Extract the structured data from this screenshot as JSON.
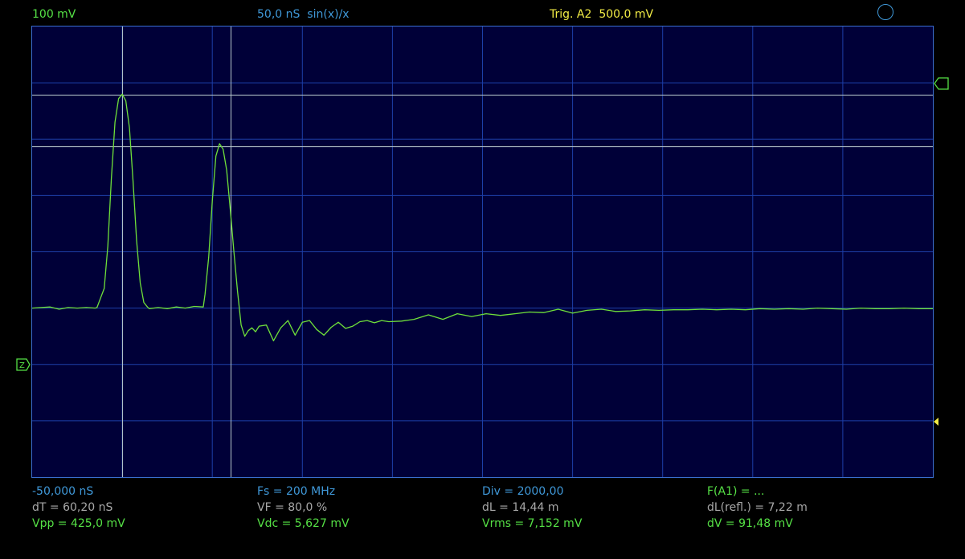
{
  "header": {
    "volts_div": "100 mV",
    "timebase": "50,0 nS",
    "interpolation": "sin(x)/x",
    "trigger_source": "Trig. A2",
    "trigger_level": "500,0 mV"
  },
  "colors": {
    "trace": "#6fe03a",
    "grid": "#1d3fa8",
    "plot_background": "#000038",
    "cursor": "#b8c8cc",
    "label_green": "#55e045",
    "label_blue": "#3f98d8",
    "label_yellow": "#f2ec45",
    "label_gray": "#a8a8a8"
  },
  "markers": {
    "zero_icon": "ground-zero-marker-icon",
    "trigger_icon": "trigger-level-marker-icon",
    "offset_icon": "offset-arrow-icon"
  },
  "measurements": {
    "row1": {
      "start_time": "-50,000 nS",
      "sample_rate": "Fs = 200 MHz",
      "division": "Div = 2000,00",
      "function": "F(A1) = ..."
    },
    "row2": {
      "delta_t": "dT = 60,20 nS",
      "velocity_factor": "VF = 80,0 %",
      "delta_length": "dL = 14,44 m",
      "delta_length_refl": "dL(refl.) = 7,22 m"
    },
    "row3": {
      "vpp": "Vpp = 425,0 mV",
      "vdc": "Vdc = 5,627 mV",
      "vrms": "Vrms = 7,152 mV",
      "delta_v": "dV = 91,48 mV"
    }
  },
  "chart_data": {
    "type": "line",
    "title": "",
    "xlabel": "",
    "ylabel": "",
    "x_unit": "nS",
    "y_unit": "mV",
    "x_per_div": 50,
    "y_per_div": 100,
    "xlim": [
      -50,
      450
    ],
    "ylim": [
      -300,
      500
    ],
    "grid": true,
    "divisions_x": 10,
    "divisions_y": 8,
    "cursors": {
      "t1": 0.2,
      "t2": 60.4,
      "v1": 378.2,
      "v2": 286.7
    },
    "series": [
      {
        "values_x": [
          -50,
          -40,
          -35,
          -30,
          -25,
          -20,
          -15,
          -14,
          -10,
          -8,
          -6,
          -4,
          -2,
          0,
          2,
          4,
          6,
          8,
          10,
          12,
          14,
          15,
          20,
          25,
          30,
          35,
          40,
          45,
          46,
          48,
          50,
          52,
          54,
          56,
          58,
          60,
          62,
          64,
          66,
          68,
          70,
          72,
          74,
          76,
          80,
          84,
          88,
          92,
          96,
          100,
          104,
          108,
          112,
          116,
          120,
          124,
          128,
          132,
          136,
          140,
          144,
          148,
          155,
          162,
          170,
          178,
          186,
          194,
          202,
          210,
          218,
          226,
          234,
          242,
          250,
          258,
          266,
          274,
          282,
          290,
          298,
          306,
          314,
          322,
          330,
          338,
          346,
          354,
          362,
          370,
          378,
          386,
          394,
          402,
          410,
          418,
          426,
          434,
          442,
          450
        ],
        "values_y": [
          0,
          2,
          -2,
          1,
          0,
          1,
          0,
          1,
          35,
          110,
          230,
          330,
          372,
          380,
          368,
          320,
          225,
          120,
          45,
          10,
          2,
          -1,
          1,
          -1,
          2,
          0,
          3,
          2,
          25,
          90,
          190,
          270,
          292,
          282,
          245,
          175,
          100,
          30,
          -30,
          -50,
          -40,
          -35,
          -42,
          -32,
          -30,
          -58,
          -35,
          -22,
          -48,
          -25,
          -22,
          -38,
          -48,
          -34,
          -25,
          -36,
          -32,
          -24,
          -22,
          -26,
          -22,
          -24,
          -23,
          -20,
          -12,
          -20,
          -10,
          -15,
          -10,
          -13,
          -10,
          -7,
          -8,
          -2,
          -9,
          -4,
          -2,
          -6,
          -5,
          -3,
          -4,
          -3,
          -3,
          -2,
          -3,
          -2,
          -3,
          -1,
          -2,
          -1,
          -2,
          0,
          -1,
          -2,
          0,
          -1,
          -1,
          0,
          -1,
          -1
        ]
      }
    ]
  }
}
